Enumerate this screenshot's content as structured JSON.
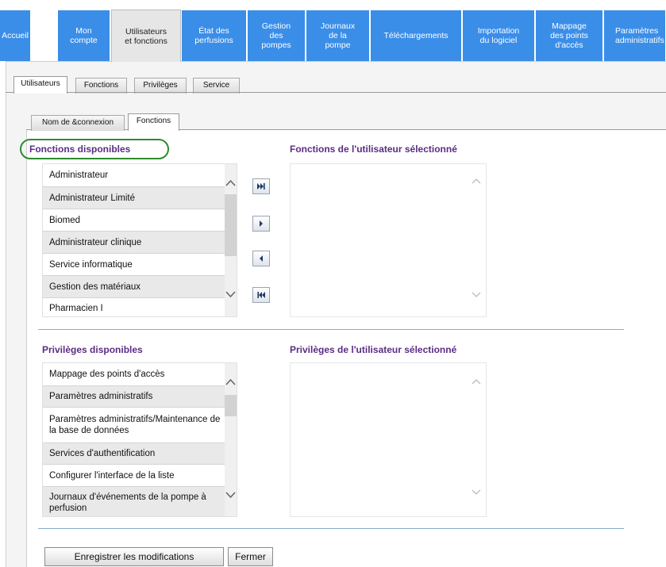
{
  "nav": {
    "tabs": [
      {
        "label": "Accueil"
      },
      {
        "label": "Mon\ncompte"
      },
      {
        "label": "Utilisateurs\net fonctions"
      },
      {
        "label": "État des\nperfusions"
      },
      {
        "label": "Gestion\ndes\npompes"
      },
      {
        "label": "Journaux\nde la\npompe"
      },
      {
        "label": "Téléchargements"
      },
      {
        "label": "Importation\ndu logiciel"
      },
      {
        "label": "Mappage\ndes points\nd'accès"
      },
      {
        "label": "Paramètres\nadministratifs"
      }
    ],
    "active_index": 2
  },
  "subtabs": [
    {
      "label": "Utilisateurs"
    },
    {
      "label": "Fonctions"
    },
    {
      "label": "Privilèges"
    },
    {
      "label": "Service"
    }
  ],
  "innertabs": [
    {
      "label": "Nom de &connexion"
    },
    {
      "label": "Fonctions"
    }
  ],
  "roles": {
    "available_title": "Fonctions disponibles",
    "selected_title": "Fonctions de l'utilisateur sélectionné",
    "available_items": [
      {
        "label": "Administrateur"
      },
      {
        "label": "Administrateur Limité"
      },
      {
        "label": "Biomed"
      },
      {
        "label": "Administrateur clinique"
      },
      {
        "label": "Service informatique"
      },
      {
        "label": "Gestion des matériaux"
      },
      {
        "label": "Pharmacien I"
      }
    ]
  },
  "privileges": {
    "available_title": "Privilèges disponibles",
    "selected_title": "Privilèges de l'utilisateur sélectionné",
    "available_items": [
      {
        "label": "Mappage des points d'accès"
      },
      {
        "label": "Paramètres administratifs"
      },
      {
        "label": "Paramètres administratifs/Maintenance de la base de données"
      },
      {
        "label": "Services d'authentification"
      },
      {
        "label": "Configurer l'interface de la liste"
      },
      {
        "label": "Journaux d'événements de la pompe à perfusion"
      }
    ]
  },
  "icons": {
    "move_all_right": "fast-forward-icon",
    "move_right": "play-icon",
    "move_left": "reverse-icon",
    "move_all_left": "fast-rewind-icon",
    "scroll_up": "chevron-up-icon",
    "scroll_down": "chevron-down-icon"
  },
  "colors": {
    "nav_blue": "#3a8ee8",
    "section_title": "#5b2c84",
    "highlight": "#2e8b2e"
  },
  "actions": {
    "save_label": "Enregistrer les modifications",
    "close_label": "Fermer"
  }
}
